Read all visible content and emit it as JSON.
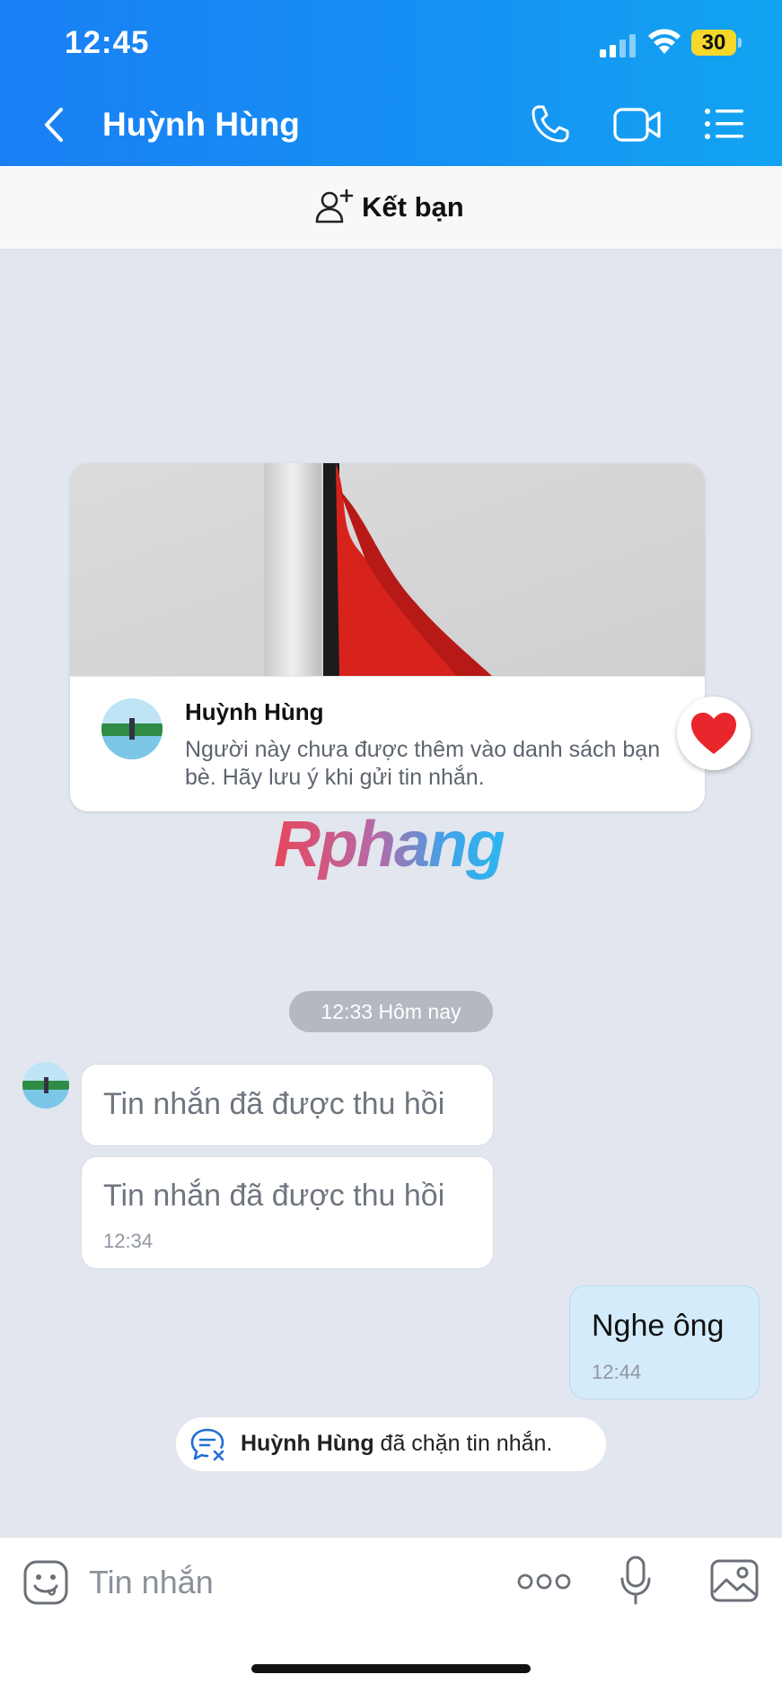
{
  "status_bar": {
    "time": "12:45",
    "battery": "30"
  },
  "header": {
    "back_icon": "chevron-left-icon",
    "title": "Huỳnh Hùng",
    "call_icon": "phone-icon",
    "video_icon": "video-camera-icon",
    "menu_icon": "list-menu-icon"
  },
  "friend_bar": {
    "icon": "add-friend-icon",
    "label": "Kết bạn"
  },
  "profile_card": {
    "name": "Huỳnh Hùng",
    "note": "Người này chưa được thêm vào danh sách bạn bè. Hãy lưu ý khi gửi tin nhắn.",
    "reaction": "heart-icon"
  },
  "watermark": "Rphang",
  "messages": {
    "time_divider": "12:33 Hôm nay",
    "received": [
      {
        "text": "Tin nhắn đã được thu hồi",
        "time": ""
      },
      {
        "text": "Tin nhắn đã được thu hồi",
        "time": "12:34"
      }
    ],
    "sent": [
      {
        "text": "Nghe ông",
        "time": "12:44"
      }
    ]
  },
  "blocked_notice": {
    "name": "Huỳnh Hùng",
    "text": " đã chặn tin nhắn."
  },
  "input_bar": {
    "placeholder": "Tin nhắn",
    "emoji_icon": "sticker-face-icon",
    "more_icon": "more-dots-icon",
    "mic_icon": "microphone-icon",
    "image_icon": "image-icon"
  },
  "colors": {
    "header_start": "#1a7ff5",
    "header_end": "#12a4f1",
    "chat_bg": "#e2e6ee",
    "sent_bubble": "#d4ebfb",
    "battery_badge": "#f5d82a"
  }
}
